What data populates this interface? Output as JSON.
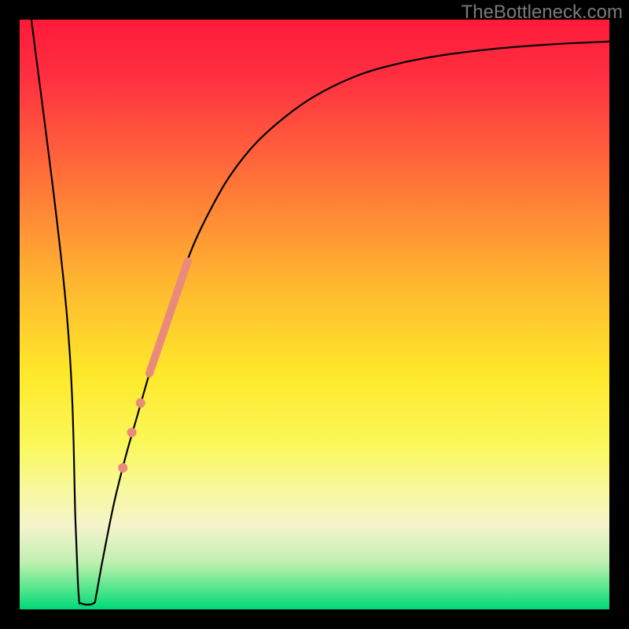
{
  "watermark": "TheBottleneck.com",
  "chart_data": {
    "type": "line",
    "title": "",
    "xlabel": "",
    "ylabel": "",
    "xlim": [
      0,
      100
    ],
    "ylim": [
      0,
      100
    ],
    "background": {
      "type": "vertical-gradient",
      "stops": [
        {
          "pos": 0.0,
          "color": "#ff1a3a"
        },
        {
          "pos": 0.1,
          "color": "#ff3040"
        },
        {
          "pos": 0.25,
          "color": "#ff6a3a"
        },
        {
          "pos": 0.45,
          "color": "#ffb830"
        },
        {
          "pos": 0.6,
          "color": "#ffe82a"
        },
        {
          "pos": 0.72,
          "color": "#faf85a"
        },
        {
          "pos": 0.8,
          "color": "#f8f8a0"
        },
        {
          "pos": 0.86,
          "color": "#f4f4cc"
        },
        {
          "pos": 0.92,
          "color": "#c0f0b0"
        },
        {
          "pos": 0.96,
          "color": "#60e890"
        },
        {
          "pos": 1.0,
          "color": "#00d878"
        }
      ]
    },
    "series": [
      {
        "name": "bottleneck-curve",
        "color": "#000000",
        "width": 2.2,
        "data": [
          {
            "x": 2.0,
            "y": 100.0
          },
          {
            "x": 8.0,
            "y": 50.0
          },
          {
            "x": 9.5,
            "y": 14.0
          },
          {
            "x": 10.0,
            "y": 2.5
          },
          {
            "x": 10.5,
            "y": 1.0
          },
          {
            "x": 12.5,
            "y": 1.0
          },
          {
            "x": 13.0,
            "y": 2.5
          },
          {
            "x": 14.0,
            "y": 8.0
          },
          {
            "x": 16.0,
            "y": 18.0
          },
          {
            "x": 18.0,
            "y": 26.0
          },
          {
            "x": 20.0,
            "y": 33.0
          },
          {
            "x": 22.0,
            "y": 40.0
          },
          {
            "x": 24.0,
            "y": 46.5
          },
          {
            "x": 26.0,
            "y": 52.5
          },
          {
            "x": 28.0,
            "y": 58.0
          },
          {
            "x": 30.0,
            "y": 63.0
          },
          {
            "x": 33.0,
            "y": 69.0
          },
          {
            "x": 36.0,
            "y": 74.0
          },
          {
            "x": 40.0,
            "y": 79.0
          },
          {
            "x": 45.0,
            "y": 83.5
          },
          {
            "x": 50.0,
            "y": 87.0
          },
          {
            "x": 56.0,
            "y": 90.0
          },
          {
            "x": 62.0,
            "y": 92.0
          },
          {
            "x": 70.0,
            "y": 93.7
          },
          {
            "x": 80.0,
            "y": 95.0
          },
          {
            "x": 90.0,
            "y": 95.8
          },
          {
            "x": 100.0,
            "y": 96.3
          }
        ]
      }
    ],
    "marker_band": {
      "name": "highlight-band",
      "color": "#e98a7a",
      "width": 10,
      "data": [
        {
          "x": 22.0,
          "y": 40.0
        },
        {
          "x": 28.5,
          "y": 59.0
        }
      ]
    },
    "marker_dots": {
      "name": "highlight-dots",
      "color": "#e98a7a",
      "radius": 6,
      "data": [
        {
          "x": 20.5,
          "y": 35.0
        },
        {
          "x": 19.0,
          "y": 30.0
        },
        {
          "x": 17.5,
          "y": 24.0
        }
      ]
    }
  }
}
